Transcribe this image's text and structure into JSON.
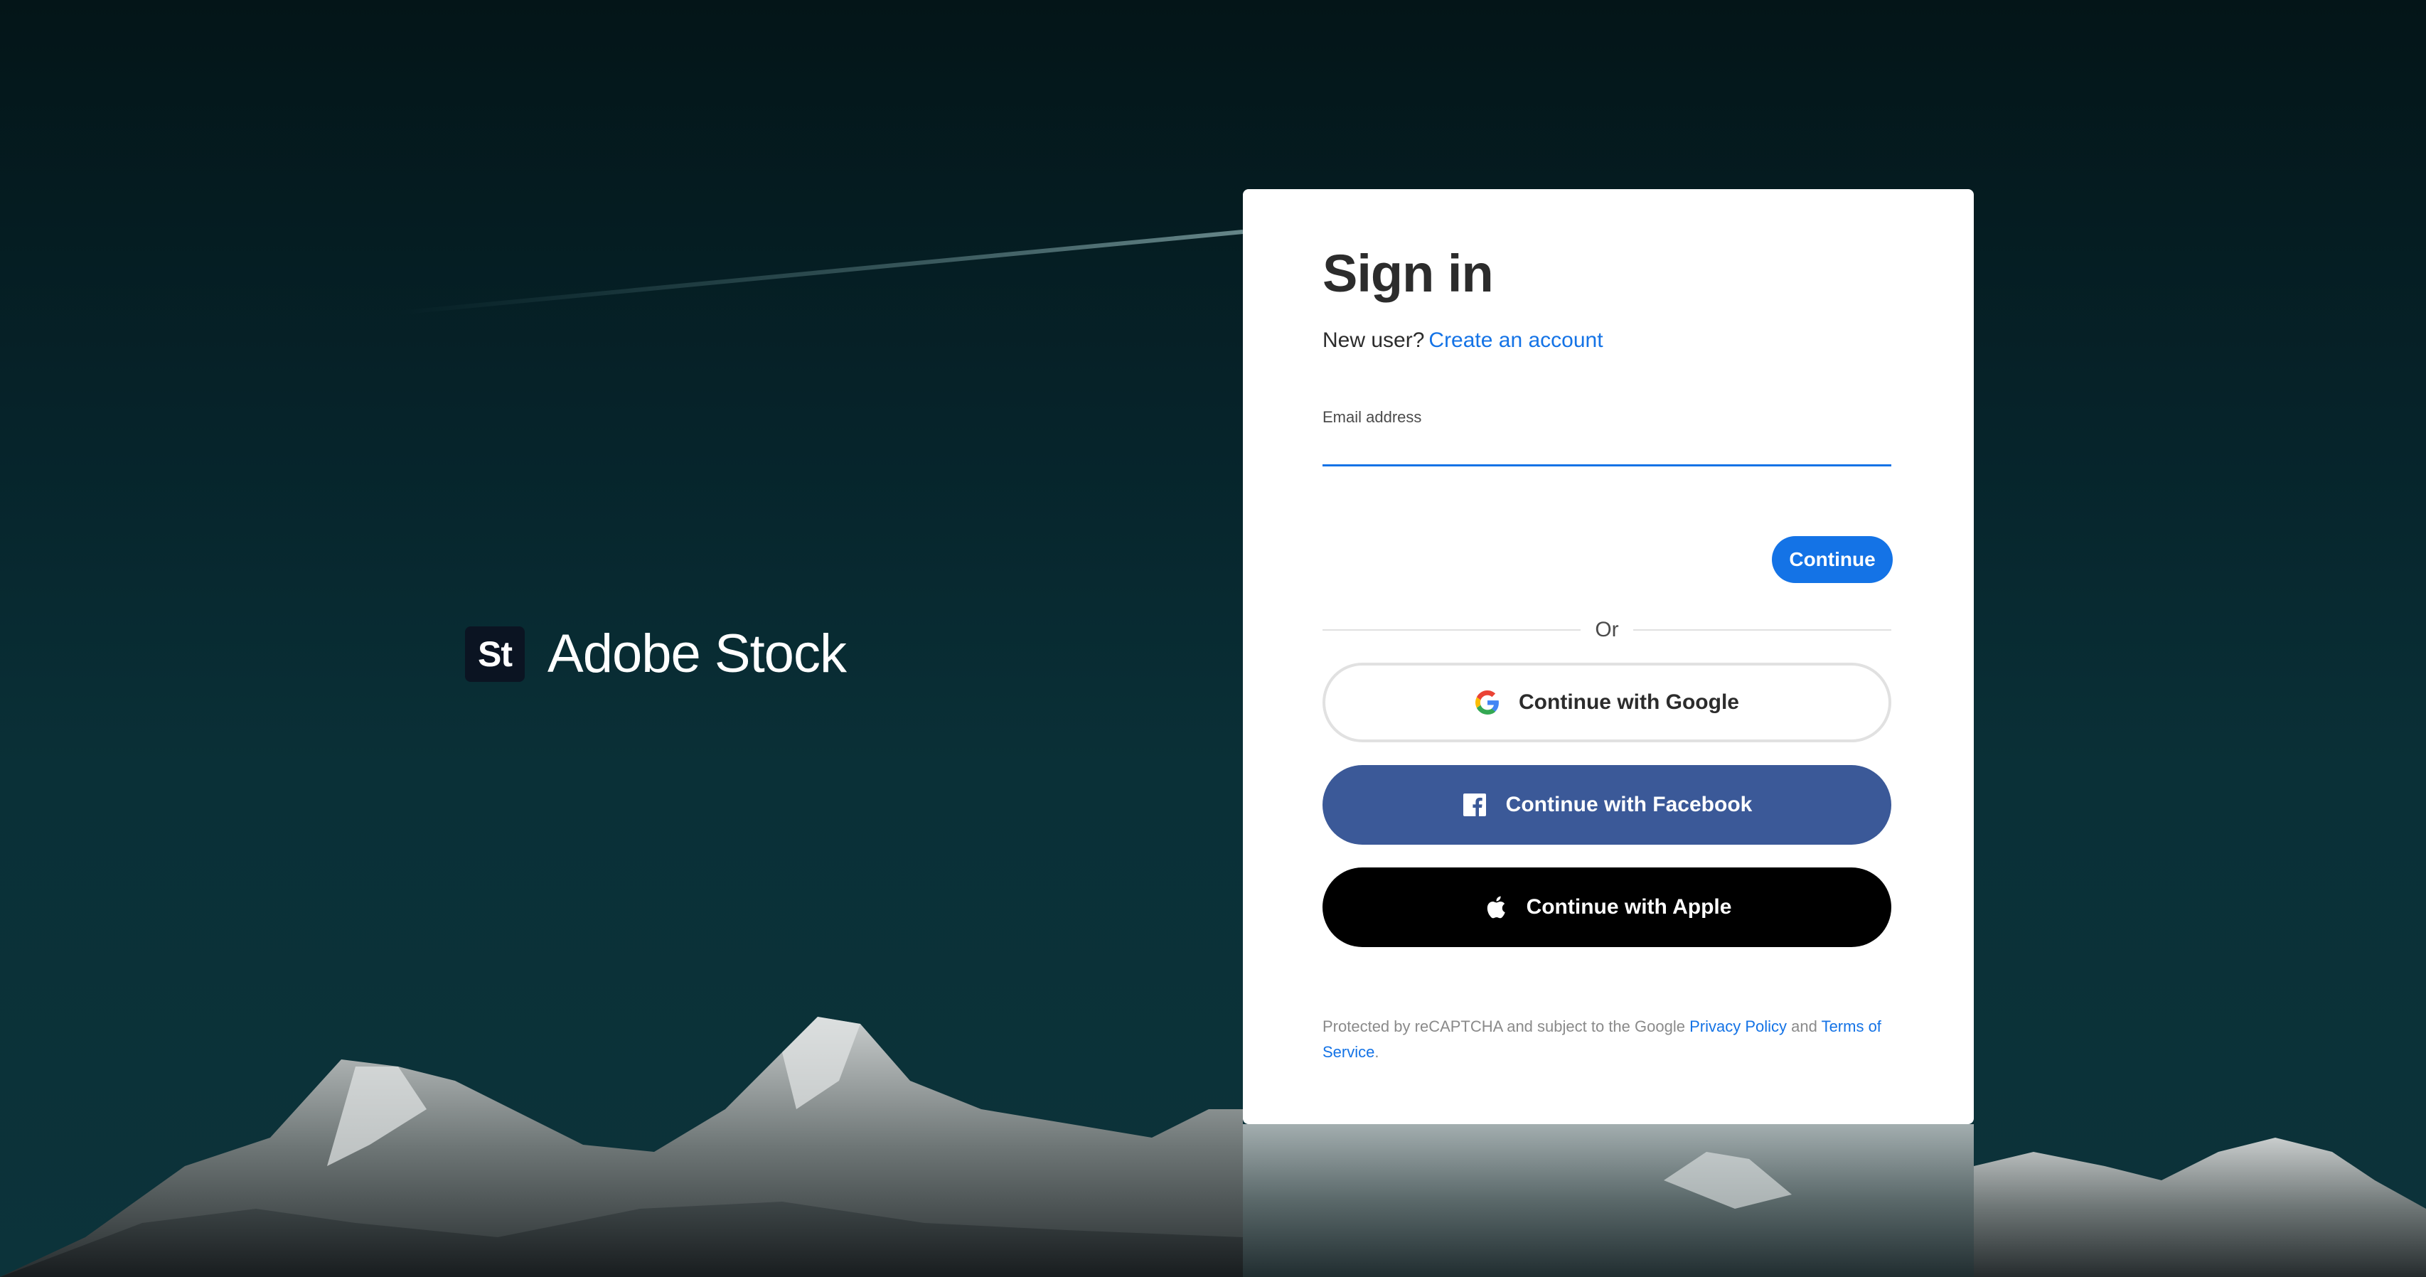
{
  "brand": {
    "logo_text": "St",
    "name": "Adobe Stock"
  },
  "signin": {
    "title": "Sign in",
    "new_user_text": "New user?",
    "create_account_link": "Create an account",
    "email_label": "Email address",
    "email_value": "",
    "continue_label": "Continue",
    "or_text": "Or"
  },
  "social": {
    "google_label": "Continue with Google",
    "facebook_label": "Continue with Facebook",
    "apple_label": "Continue with Apple",
    "google_icon": "google-icon",
    "facebook_icon": "facebook-icon",
    "apple_icon": "apple-icon"
  },
  "legal": {
    "prefix": "Protected by reCAPTCHA and subject to the Google",
    "privacy_link": "Privacy Policy",
    "and_text": "and",
    "terms_link": "Terms of Service",
    "suffix": "."
  },
  "colors": {
    "accent": "#1473e6",
    "facebook": "#3b5998",
    "apple": "#000000",
    "background": "#06242b"
  }
}
